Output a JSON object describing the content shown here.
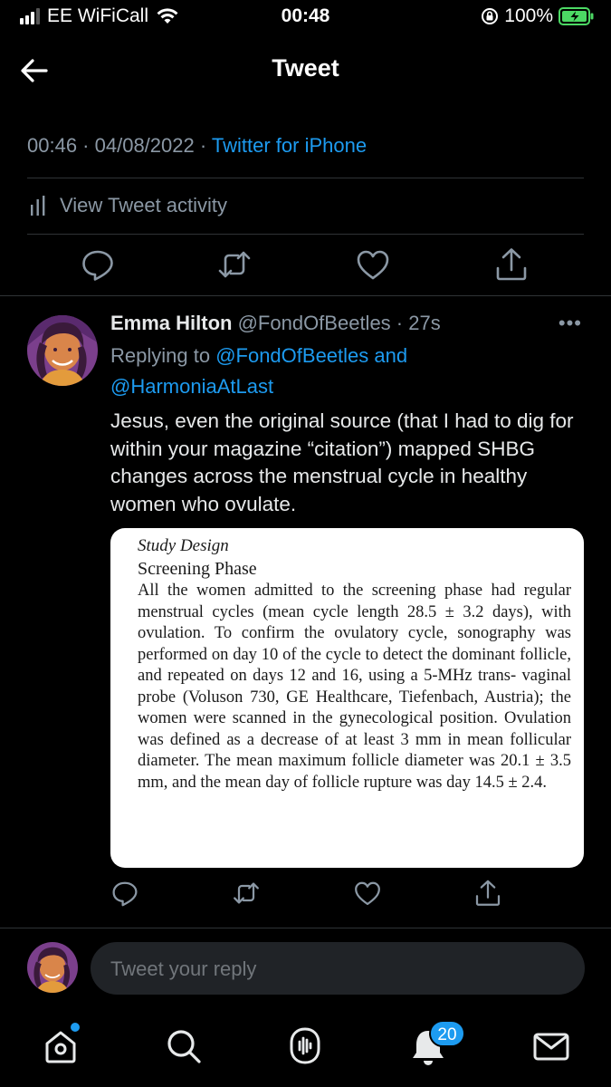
{
  "status_bar": {
    "carrier": "EE WiFiCall",
    "time": "00:48",
    "battery": "100%"
  },
  "header": {
    "title": "Tweet",
    "back_icon": "arrow-left-icon"
  },
  "tweet_meta": {
    "time": "00:46",
    "sep1": " · ",
    "date": "04/08/2022",
    "sep2": " · ",
    "source": "Twitter for iPhone"
  },
  "tweet_activity": {
    "label": "View Tweet activity"
  },
  "main_actions": [
    "reply-icon",
    "retweet-icon",
    "like-icon",
    "share-icon"
  ],
  "reply": {
    "name": "Emma Hilton",
    "handle": "@FondOfBeetles",
    "time_sep": " · ",
    "time": "27s",
    "more": "•••",
    "replying_prefix": "Replying to ",
    "replying_to_1": "@FondOfBeetles",
    "replying_and": " and",
    "replying_to_2": "@HarmoniaAtLast",
    "text": "Jesus, even the original source (that I had to dig for within your magazine “citation”) mapped SHBG changes across the menstrual cycle in healthy women who ovulate.",
    "media": {
      "section": "Study Design",
      "heading": "Screening Phase",
      "body": "All the women admitted to the screening phase had regular menstrual cycles (mean cycle length 28.5 ± 3.2 days), with ovulation. To confirm the ovulatory cycle, sonography was performed on day 10 of the cycle to detect the dominant follicle, and repeated on days 12 and 16, using a 5-MHz trans- vaginal probe (Voluson 730, GE Healthcare, Tiefenbach, Austria); the women were scanned in the gynecological position. Ovulation was defined as a decrease of at least 3 mm in mean follicular diameter. The mean maximum follicle diameter was 20.1 ± 3.5 mm, and the mean day of follicle rupture was day 14.5 ± 2.4."
    }
  },
  "reply_box": {
    "placeholder": "Tweet your reply"
  },
  "tab_bar": {
    "notifications_count": "20",
    "items": [
      "home-icon",
      "search-icon",
      "spaces-icon",
      "notifications-icon",
      "messages-icon"
    ]
  },
  "colors": {
    "background": "#000000",
    "accent": "#1d9bf0",
    "secondary_text": "#8b98a5",
    "divider": "#2f3336"
  }
}
